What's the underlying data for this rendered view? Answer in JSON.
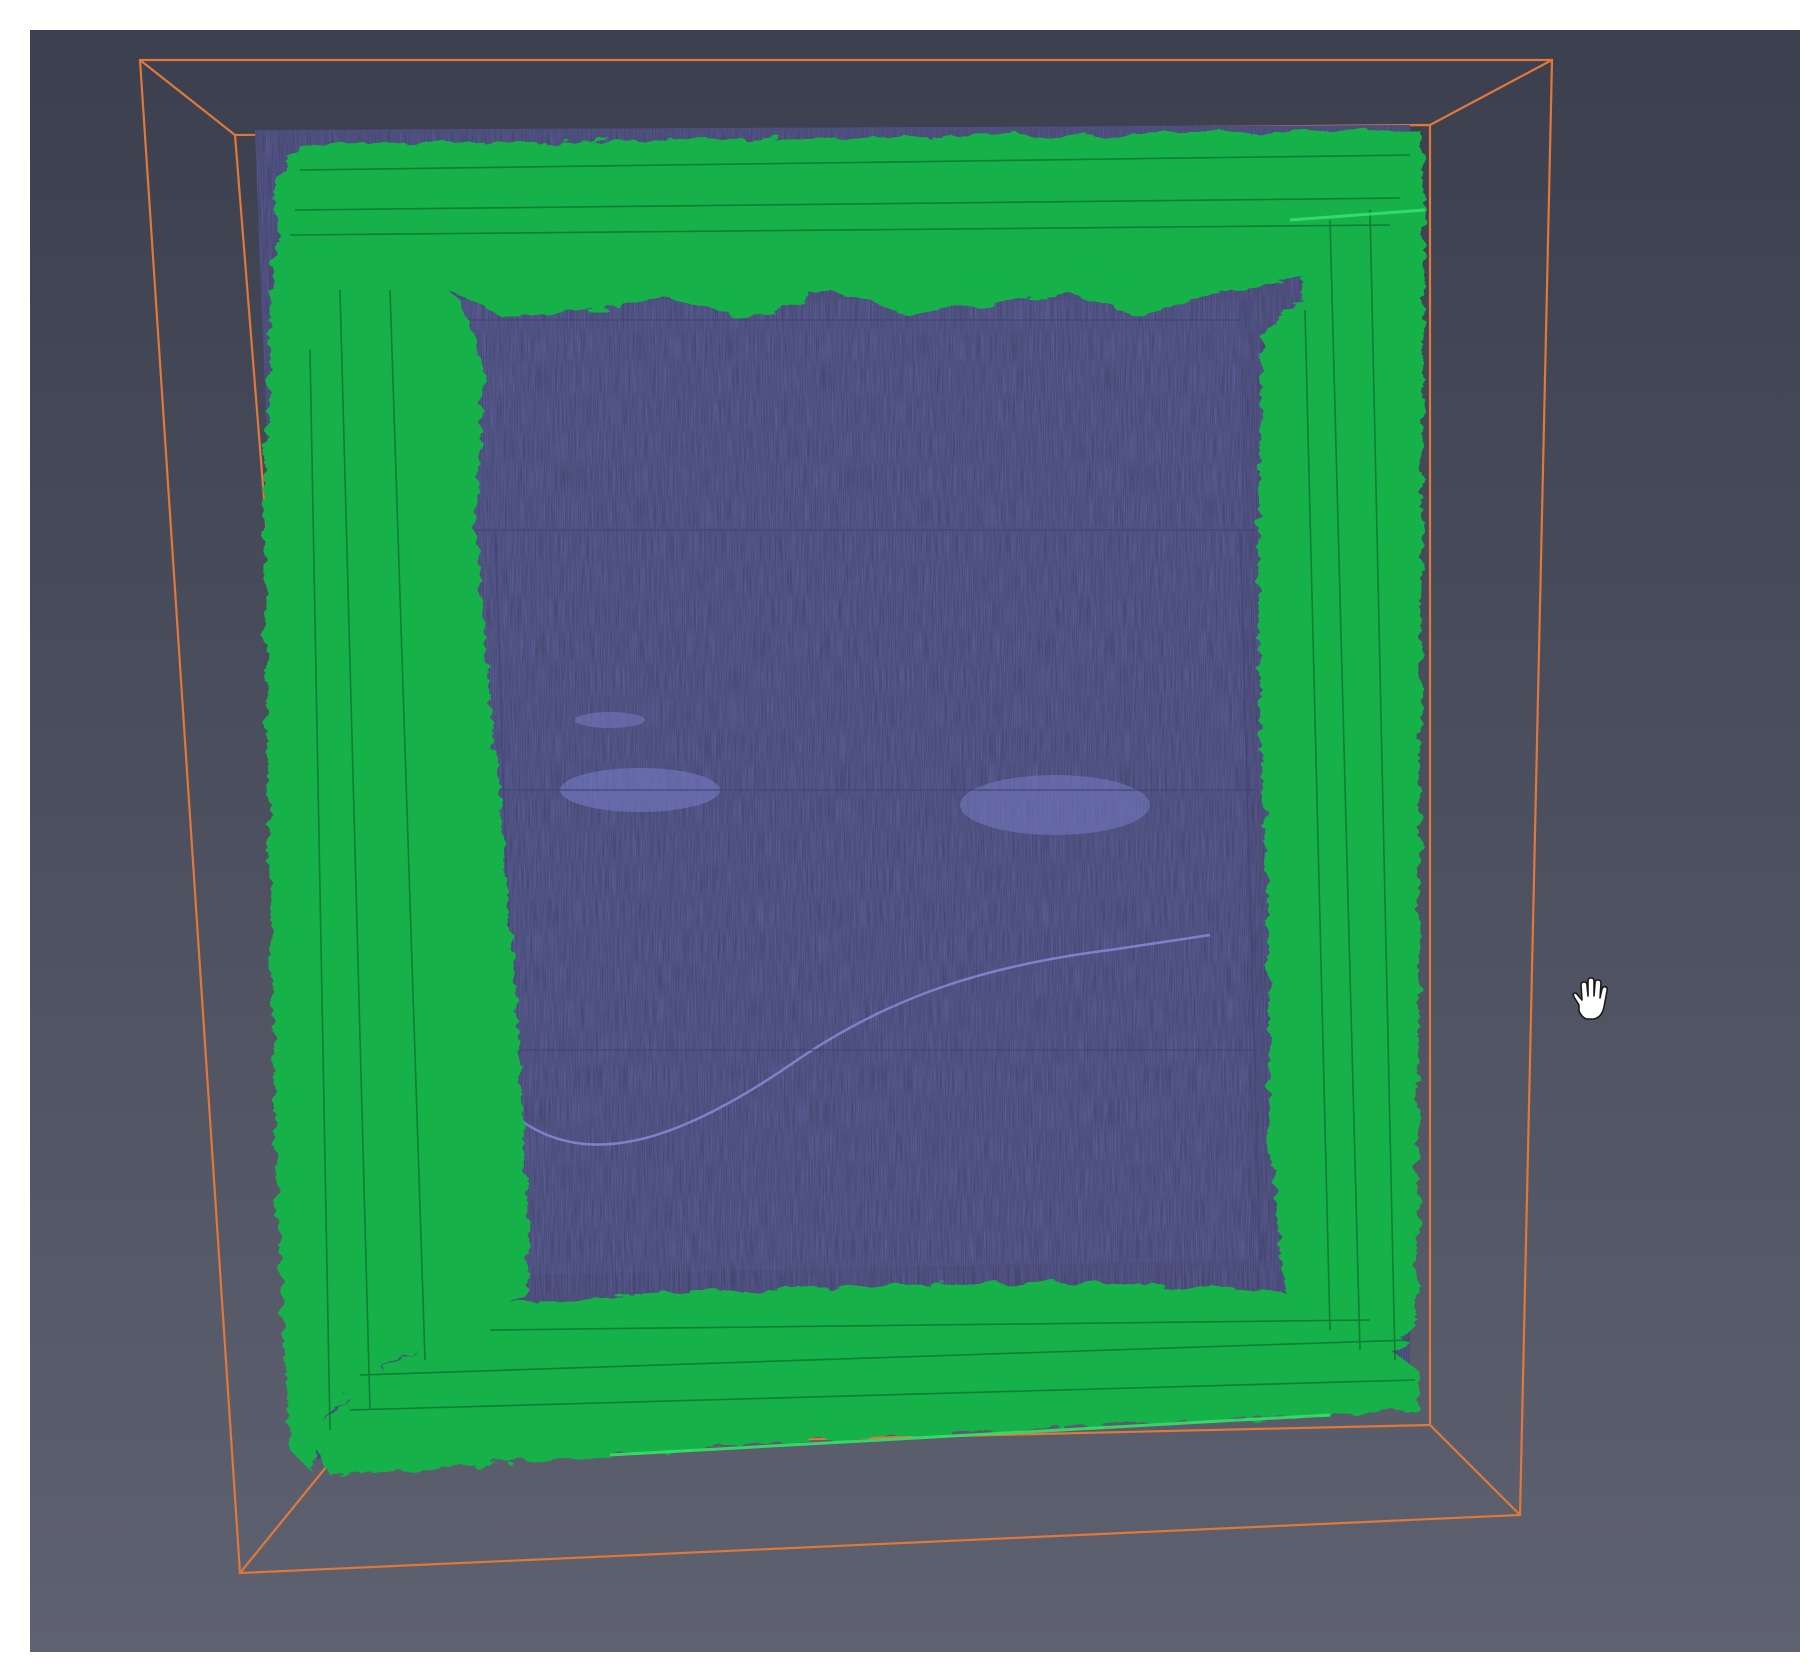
{
  "viewer": {
    "background_top": "#3b3f4e",
    "background_bottom": "#5e6170",
    "bounding_box_color": "#e0783a",
    "volume_color": "#5d5f97",
    "segmentation_color": "#12b24a",
    "cursor_icon": "hand-pan-icon"
  }
}
